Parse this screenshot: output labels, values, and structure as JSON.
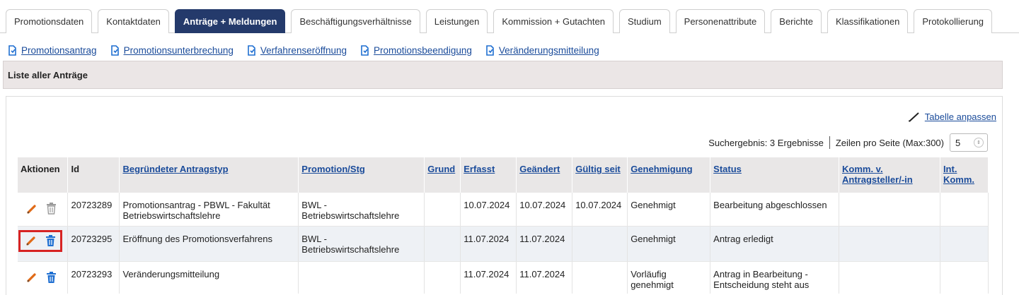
{
  "tabs": [
    {
      "label": "Promotionsdaten",
      "active": false
    },
    {
      "label": "Kontaktdaten",
      "active": false
    },
    {
      "label": "Anträge + Meldungen",
      "active": true
    },
    {
      "label": "Beschäftigungsverhältnisse",
      "active": false
    },
    {
      "label": "Leistungen",
      "active": false
    },
    {
      "label": "Kommission + Gutachten",
      "active": false
    },
    {
      "label": "Studium",
      "active": false
    },
    {
      "label": "Personenattribute",
      "active": false
    },
    {
      "label": "Berichte",
      "active": false
    },
    {
      "label": "Klassifikationen",
      "active": false
    },
    {
      "label": "Protokollierung",
      "active": false
    }
  ],
  "links": [
    {
      "label": "Promotionsantrag",
      "icon": "new-document-icon"
    },
    {
      "label": "Promotionsunterbrechung",
      "icon": "new-document-icon"
    },
    {
      "label": "Verfahrenseröffnung",
      "icon": "new-document-icon"
    },
    {
      "label": "Promotionsbeendigung",
      "icon": "new-document-icon"
    },
    {
      "label": "Veränderungsmitteilung",
      "icon": "new-document-icon"
    }
  ],
  "list_title": "Liste aller Anträge",
  "adjust_label": "Tabelle anpassen",
  "search": {
    "result_text": "Suchergebnis: 3 Ergebnisse",
    "rows_label": "Zeilen pro Seite (Max:300)",
    "rows_value": "5"
  },
  "table": {
    "headers": {
      "aktionen": "Aktionen",
      "id": "Id",
      "typ": "Begründeter Antragstyp",
      "promotion": "Promotion/Stg",
      "grund": "Grund",
      "erfasst": "Erfasst",
      "geaendert": "Geändert",
      "gueltig": "Gültig seit",
      "genehmigung": "Genehmigung",
      "status": "Status",
      "komm_v": "Komm. v. Antragsteller/-in",
      "int_komm": "Int. Komm."
    },
    "rows": [
      {
        "id": "20723289",
        "typ": "Promotionsantrag - PBWL - Fakultät Betriebswirtschaftslehre",
        "promotion": "BWL - Betriebswirtschaftslehre",
        "grund": "",
        "erfasst": "10.07.2024",
        "geaendert": "10.07.2024",
        "gueltig": "10.07.2024",
        "genehmigung": "Genehmigt",
        "status": "Bearbeitung abgeschlossen",
        "komm_v": "",
        "int_komm": ""
      },
      {
        "id": "20723295",
        "typ": "Eröffnung des Promotionsverfahrens",
        "promotion": "BWL - Betriebswirtschaftslehre",
        "grund": "",
        "erfasst": "11.07.2024",
        "geaendert": "11.07.2024",
        "gueltig": "",
        "genehmigung": "Genehmigt",
        "status": "Antrag erledigt",
        "komm_v": "",
        "int_komm": ""
      },
      {
        "id": "20723293",
        "typ": "Veränderungsmitteilung",
        "promotion": "",
        "grund": "",
        "erfasst": "11.07.2024",
        "geaendert": "11.07.2024",
        "gueltig": "",
        "genehmigung": "Vorläufig genehmigt",
        "status": "Antrag in Bearbeitung - Entscheidung steht aus",
        "komm_v": "",
        "int_komm": ""
      }
    ]
  },
  "colors": {
    "active_tab": "#243a6b",
    "link": "#1a4b9a",
    "edit_icon": "#e06a17",
    "delete_icon_active": "#1f6fd1",
    "delete_icon_disabled": "#9b9b9b",
    "highlight_box": "#d72323"
  }
}
